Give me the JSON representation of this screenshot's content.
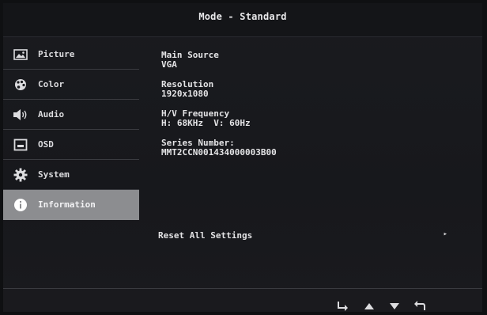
{
  "header": {
    "title": "Mode - Standard"
  },
  "menu": [
    {
      "label": "Picture",
      "icon": "picture-icon"
    },
    {
      "label": "Color",
      "icon": "color-palette-icon"
    },
    {
      "label": "Audio",
      "icon": "speaker-icon"
    },
    {
      "label": "OSD",
      "icon": "osd-window-icon"
    },
    {
      "label": "System",
      "icon": "gear-icon"
    },
    {
      "label": "Information",
      "icon": "info-icon",
      "active": true
    }
  ],
  "info": {
    "main_source_label": "Main Source",
    "main_source_value": "VGA",
    "resolution_label": "Resolution",
    "resolution_value": "1920x1080",
    "frequency_label": "H/V Frequency",
    "frequency_value": "H: 68KHz  V: 60Hz",
    "serial_label": "Series Number:",
    "serial_value": "MMT2CCN001434000003B00"
  },
  "reset": {
    "label": "Reset All Settings",
    "arrow": "▸"
  },
  "bottom_nav": [
    "enter-icon",
    "up-arrow-icon",
    "down-arrow-icon",
    "back-icon"
  ],
  "colors": {
    "active_bg": "#8c8d90",
    "background": "#17181c",
    "text": "#e4e4e6"
  }
}
